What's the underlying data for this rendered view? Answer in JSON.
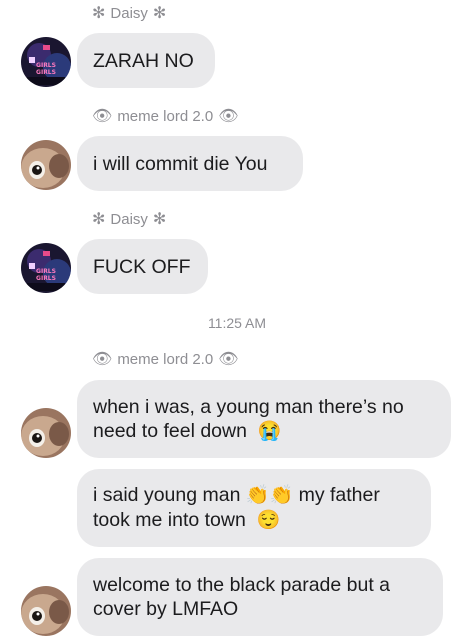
{
  "thread": {
    "messages": [
      {
        "sender": "Daisy",
        "sender_prefix": "✻",
        "sender_suffix": "✻",
        "text": "ZARAH NO"
      },
      {
        "sender": "meme lord 2.0",
        "sender_prefix": "👁",
        "sender_suffix": "👁",
        "text": "i will commit die You"
      },
      {
        "sender": "Daisy",
        "sender_prefix": "✻",
        "sender_suffix": "✻",
        "text": "FUCK OFF"
      },
      {
        "timestamp": "11:25 AM"
      },
      {
        "sender": "meme lord 2.0",
        "sender_prefix": "👁",
        "sender_suffix": "👁",
        "text_line1": "when i was, a young man there’s no",
        "text_line2": "need to feel down",
        "emoji": "😭"
      },
      {
        "text_line1": "i said young man",
        "emoji1": "👏👏",
        "text_line1b": "my father",
        "text_line2": "took me into town",
        "emoji2": "😌"
      },
      {
        "text_line1": "welcome to the black parade but a",
        "text_line2": "cover by LMFAO"
      }
    ]
  },
  "avatars": {
    "daisy_text": "GIRLS\nGIRLS"
  }
}
